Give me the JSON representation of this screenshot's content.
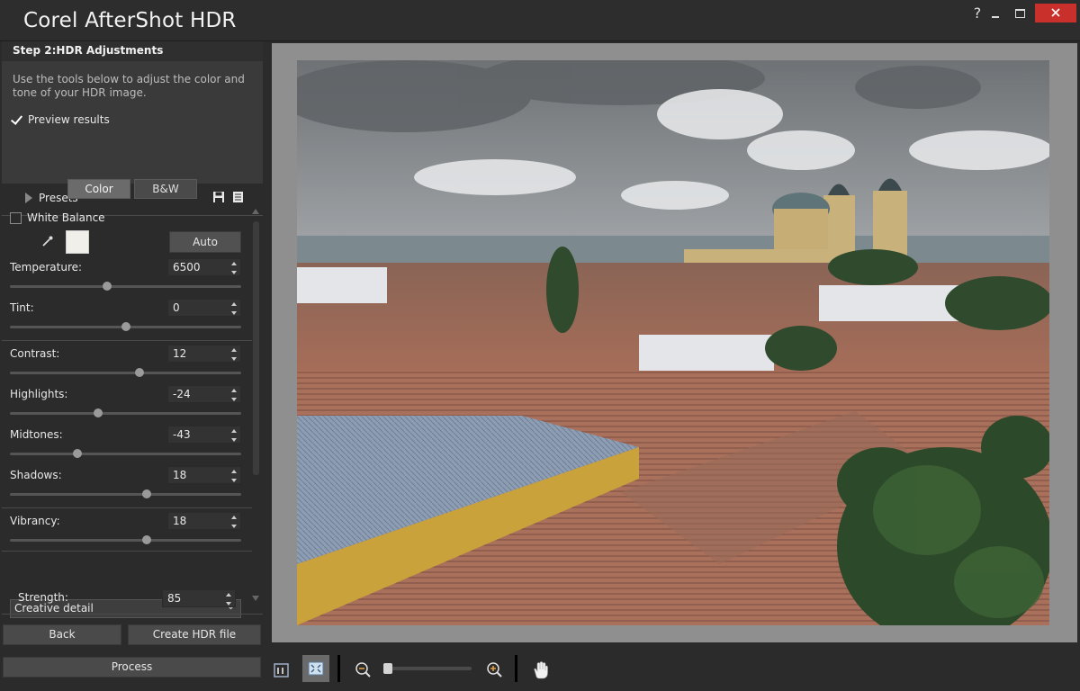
{
  "window": {
    "title": "Corel AfterShot HDR",
    "help_glyph": "?"
  },
  "panel": {
    "step_title": "Step 2:HDR Adjustments",
    "instructions": "Use the tools below to adjust the color and tone of your HDR image.",
    "preview_label": "Preview results",
    "presets_label": "Presets",
    "tabs": {
      "color": "Color",
      "bw": "B&W"
    },
    "white_balance_label": "White Balance",
    "auto_label": "Auto",
    "controls": [
      {
        "label": "Temperature:",
        "value": "6500",
        "slider": 0.42
      },
      {
        "label": "Tint:",
        "value": "0",
        "slider": 0.5
      },
      {
        "label": "Contrast:",
        "value": "12",
        "slider": 0.56
      },
      {
        "label": "Highlights:",
        "value": "-24",
        "slider": 0.38
      },
      {
        "label": "Midtones:",
        "value": "-43",
        "slider": 0.29
      },
      {
        "label": "Shadows:",
        "value": "18",
        "slider": 0.59
      },
      {
        "label": "Vibrancy:",
        "value": "18",
        "slider": 0.59
      }
    ],
    "creative_detail_option": "Creative detail",
    "strength_label": "Strength:",
    "strength_value": "85"
  },
  "buttons": {
    "back": "Back",
    "create": "Create HDR file",
    "process": "Process"
  },
  "zoom": {
    "level_fraction": 0.06
  },
  "colors": {
    "accent_close": "#c9302c",
    "panel_bg": "#2b2b2b",
    "preview_frame": "#8f8f8f"
  },
  "icons": {
    "save": "save-icon",
    "list": "list-icon",
    "dropper": "eyedropper-icon",
    "fit": "fit-view-icon",
    "actual": "actual-size-icon",
    "zoom_out": "zoom-out-icon",
    "zoom_in": "zoom-in-icon",
    "hand": "hand-tool-icon"
  }
}
